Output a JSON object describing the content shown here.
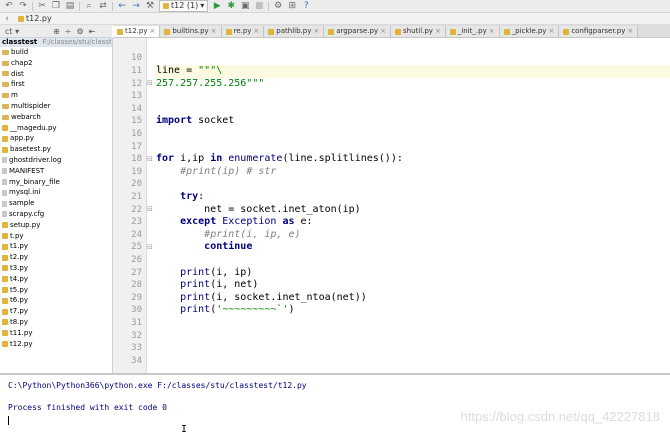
{
  "toolbar": {
    "run_config": "t12 (1)"
  },
  "navbar": {
    "file": "t12.py"
  },
  "project": {
    "root_name": "classtest",
    "root_path": "F:/classes/stu/classtest",
    "items": [
      {
        "name": "build",
        "type": "folder"
      },
      {
        "name": "chap2",
        "type": "folder"
      },
      {
        "name": "dist",
        "type": "folder"
      },
      {
        "name": "first",
        "type": "folder"
      },
      {
        "name": "m",
        "type": "folder"
      },
      {
        "name": "multispider",
        "type": "folder"
      },
      {
        "name": "webarch",
        "type": "folder"
      },
      {
        "name": "__magedu.py",
        "type": "py"
      },
      {
        "name": "app.py",
        "type": "py"
      },
      {
        "name": "basetest.py",
        "type": "py"
      },
      {
        "name": "ghostdriver.log",
        "type": "file"
      },
      {
        "name": "MANIFEST",
        "type": "file"
      },
      {
        "name": "my_binary_file",
        "type": "file"
      },
      {
        "name": "mysql.ini",
        "type": "file"
      },
      {
        "name": "sample",
        "type": "file"
      },
      {
        "name": "scrapy.cfg",
        "type": "file"
      },
      {
        "name": "setup.py",
        "type": "py"
      },
      {
        "name": "t.py",
        "type": "py"
      },
      {
        "name": "t1.py",
        "type": "py"
      },
      {
        "name": "t2.py",
        "type": "py"
      },
      {
        "name": "t3.py",
        "type": "py"
      },
      {
        "name": "t4.py",
        "type": "py"
      },
      {
        "name": "t5.py",
        "type": "py"
      },
      {
        "name": "t6.py",
        "type": "py"
      },
      {
        "name": "t7.py",
        "type": "py"
      },
      {
        "name": "t8.py",
        "type": "py"
      },
      {
        "name": "t11.py",
        "type": "py"
      },
      {
        "name": "t12.py",
        "type": "py"
      }
    ]
  },
  "tabs": [
    {
      "label": "t12.py",
      "active": true
    },
    {
      "label": "builtins.py",
      "active": false
    },
    {
      "label": "re.py",
      "active": false
    },
    {
      "label": "pathlib.py",
      "active": false
    },
    {
      "label": "argparse.py",
      "active": false
    },
    {
      "label": "shutil.py",
      "active": false
    },
    {
      "label": "_init_.py",
      "active": false
    },
    {
      "label": "_pickle.py",
      "active": false
    },
    {
      "label": "configparser.py",
      "active": false
    }
  ],
  "editor": {
    "current_line": 11,
    "line_numbers": [
      "10",
      "11",
      "12",
      "13",
      "14",
      "15",
      "16",
      "17",
      "18",
      "19",
      "20",
      "21",
      "22",
      "23",
      "24",
      "25",
      "26",
      "27",
      "28",
      "29",
      "30",
      "31",
      "32",
      "33",
      "34"
    ]
  },
  "console": {
    "command": "C:\\Python\\Python366\\python.exe F:/classes/stu/classtest/t12.py",
    "result": "Process finished with exit code 0"
  },
  "watermark": "https://blog.csdn.net/qq_42227818",
  "colors": {
    "keyword": "#000080",
    "string": "#008000",
    "comment": "#808080",
    "current_line_bg": "#fcfae0"
  }
}
